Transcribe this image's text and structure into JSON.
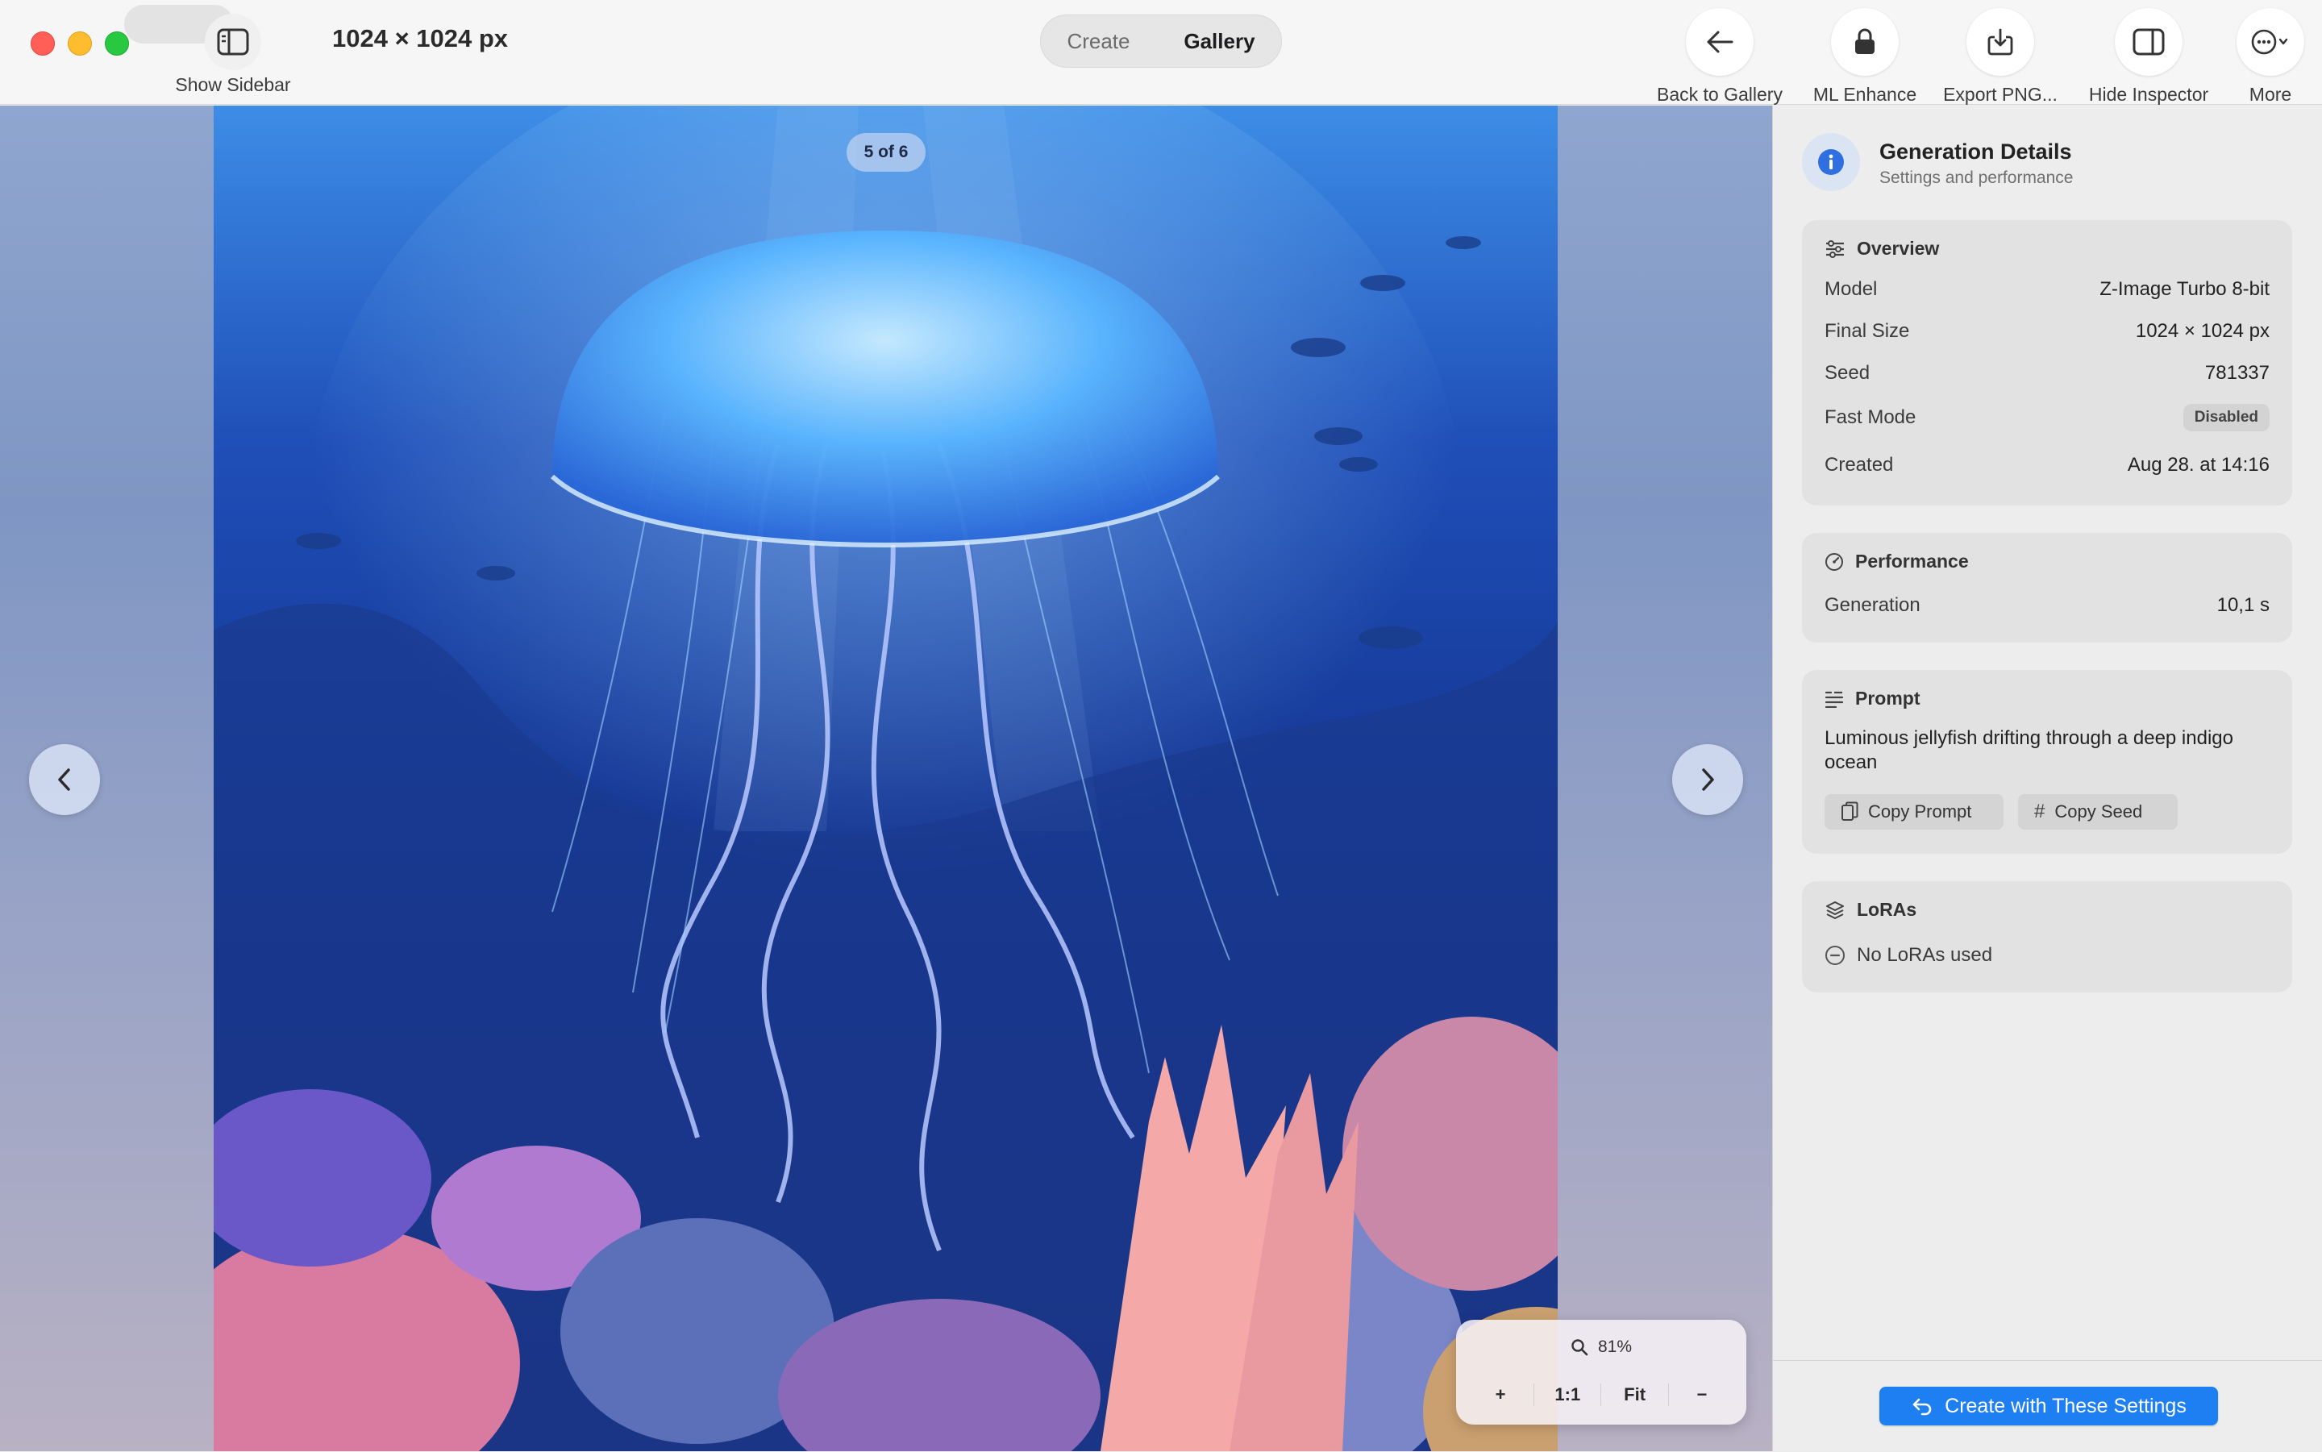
{
  "window": {
    "title": "1024 × 1024 px"
  },
  "toolbar": {
    "show_sidebar": "Show Sidebar",
    "tabs": [
      {
        "label": "Create",
        "active": false
      },
      {
        "label": "Gallery",
        "active": true
      }
    ],
    "back_to_gallery": "Back to Gallery",
    "ml_enhance": "ML Enhance",
    "export": "Export PNG...",
    "hide_inspector": "Hide Inspector",
    "more": "More"
  },
  "viewer": {
    "counter": "5 of 6",
    "zoom": {
      "level": "81%",
      "plus": "+",
      "one_to_one": "1:1",
      "fit": "Fit",
      "minus": "−"
    }
  },
  "inspector": {
    "title": "Generation Details",
    "subtitle": "Settings and performance",
    "overview": {
      "heading": "Overview",
      "rows": [
        {
          "label": "Model",
          "value": "Z-Image Turbo 8-bit"
        },
        {
          "label": "Final Size",
          "value": "1024 × 1024 px"
        },
        {
          "label": "Seed",
          "value": "781337"
        },
        {
          "label": "Fast Mode",
          "value": "Disabled"
        },
        {
          "label": "Created",
          "value": "Aug 28. at 14:16"
        }
      ]
    },
    "performance": {
      "heading": "Performance",
      "label": "Generation",
      "value": "10,1 s"
    },
    "prompt": {
      "heading": "Prompt",
      "text": "Luminous jellyfish drifting through a deep indigo ocean",
      "copy_prompt": "Copy Prompt",
      "copy_seed": "Copy Seed"
    },
    "loras": {
      "heading": "LoRAs",
      "empty": "No LoRAs used"
    },
    "action": "Create with These Settings"
  },
  "colors": {
    "accent": "#1d7ff2",
    "close": "#ff5f57",
    "minimize": "#febc2e",
    "maximize": "#28c840"
  }
}
